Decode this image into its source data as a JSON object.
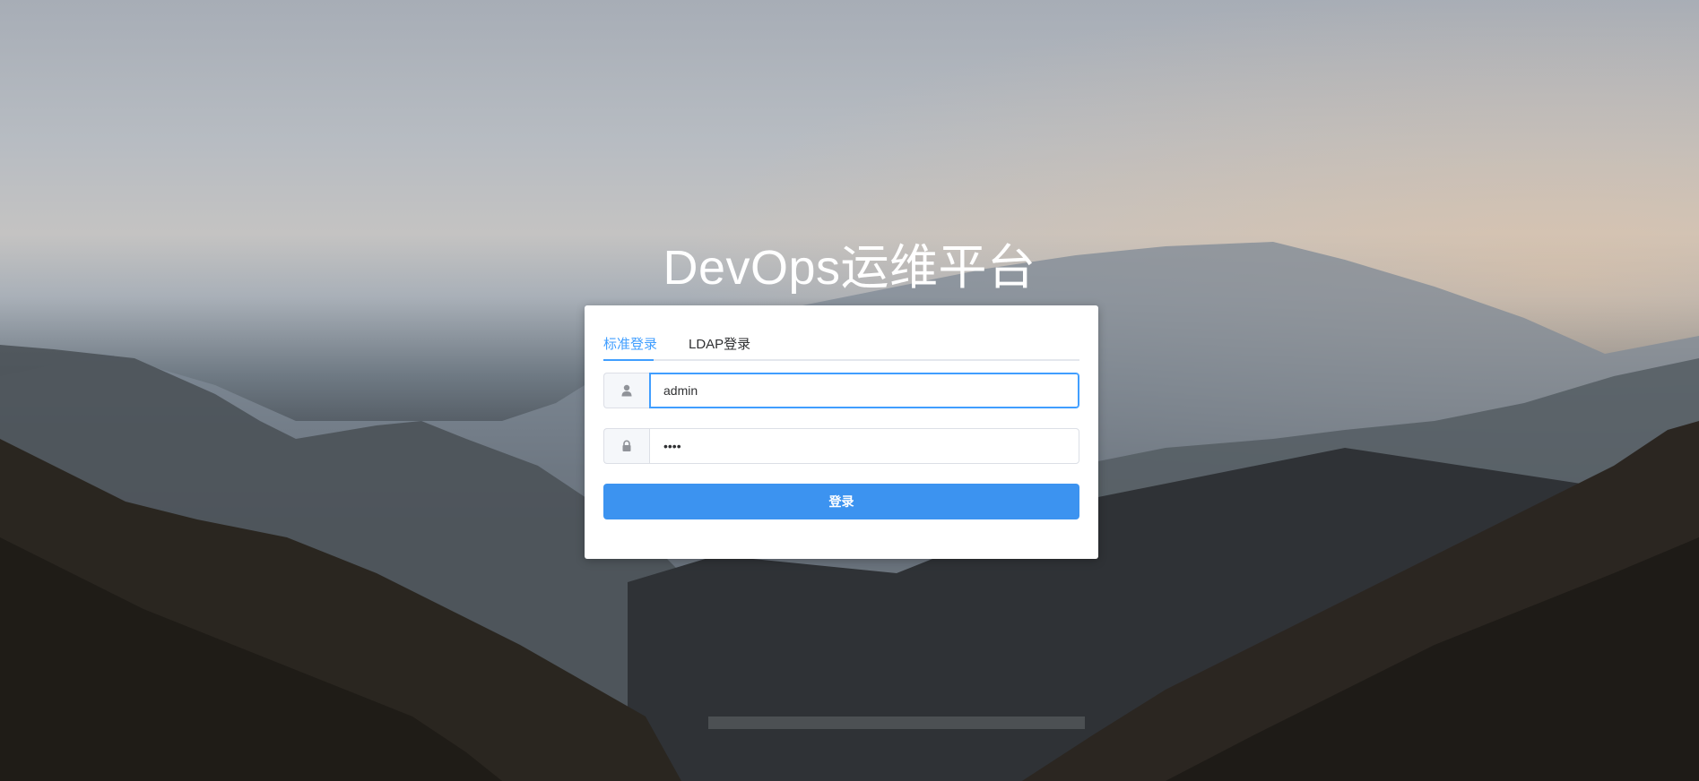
{
  "page": {
    "title": "DevOps运维平台"
  },
  "login": {
    "tabs": [
      {
        "label": "标准登录",
        "active": true
      },
      {
        "label": "LDAP登录",
        "active": false
      }
    ],
    "username": {
      "value": "admin",
      "icon": "user-icon"
    },
    "password": {
      "value": "••••",
      "icon": "lock-icon"
    },
    "submit_label": "登录"
  },
  "colors": {
    "accent": "#409eff",
    "button": "#3c93f0",
    "card": "#ffffff"
  }
}
